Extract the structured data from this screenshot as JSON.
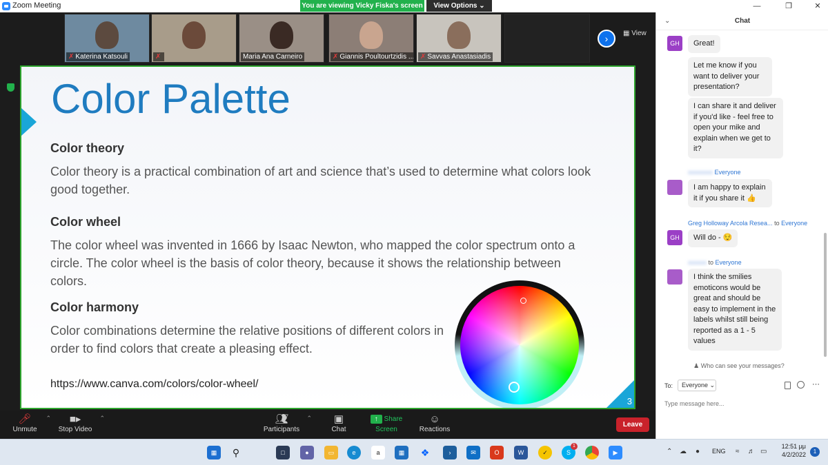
{
  "window": {
    "title": "Zoom Meeting",
    "banner": "You are viewing Vicky Fiska's screen",
    "view_options": "View Options ⌄"
  },
  "colors": {
    "accent": "#0e72ed",
    "share_green": "#22b14c",
    "slide_blue": "#1f7cc0",
    "leave_red": "#c9222b"
  },
  "participants": [
    {
      "name": "Katerina Katsouli",
      "muted": true,
      "bg": "#6e8aa0",
      "person": "#5c4a3f"
    },
    {
      "name": "",
      "muted": true,
      "bg": "#a89c8a",
      "person": "#6b4a3a"
    },
    {
      "name": "Maria Ana Carneiro",
      "muted": false,
      "bg": "#9a8f86",
      "person": "#3a2a24"
    },
    {
      "name": "Giannis Poultourtzidis ...",
      "muted": true,
      "bg": "#8c7e76",
      "person": "#c9a58f"
    },
    {
      "name": "Savvas Anastasiadis",
      "muted": true,
      "bg": "#c8c4bd",
      "person": "#8a6e5c"
    },
    {
      "name": "",
      "muted": false,
      "bg": "#222222",
      "person": "#222222"
    }
  ],
  "view_button": "View",
  "slide": {
    "title": "Color Palette",
    "sections": [
      {
        "heading": "Color theory",
        "body": "Color theory is a practical combination of art and science that’s used to determine what colors look good together."
      },
      {
        "heading": "Color wheel",
        "body": "The color wheel was invented in 1666 by Isaac Newton, who mapped the color spectrum onto a circle. The color wheel is the basis of color theory, because it shows the relationship between colors."
      },
      {
        "heading": "Color harmony",
        "body": "Color combinations determine the relative positions of different colors in order to find colors that create a pleasing effect."
      }
    ],
    "link": "https://www.canva.com/colors/color-wheel/",
    "page_number": "3"
  },
  "toolbar": {
    "unmute": "Unmute",
    "stop_video": "Stop Video",
    "participants": "Participants",
    "participants_count": "27",
    "chat": "Chat",
    "share_screen": "Share Screen",
    "reactions": "Reactions",
    "leave": "Leave"
  },
  "chat": {
    "title": "Chat",
    "messages": [
      {
        "avatar": "GH",
        "text": "Great!"
      },
      {
        "avatar": "",
        "text": "Let me know if you want to deliver your presentation?"
      },
      {
        "avatar": "",
        "text": "I can share it and deliver if you'd like - feel free to open your mike and explain when we get to it?"
      },
      {
        "sender_suffix": "Everyone",
        "avatar": "",
        "text": "I am happy to explain it if you share it 👍"
      },
      {
        "sender": "Greg Holloway Arcola Resea...",
        "sender_to": "to",
        "sender_suffix": "Everyone",
        "avatar": "GH",
        "text": "Will do - 😌"
      },
      {
        "sender_to": "to",
        "sender_suffix": "Everyone",
        "avatar": "",
        "text": "I think the smilies emoticons would be great and should be easy to implement in the labels whilst still being reported as a 1 - 5 values"
      }
    ],
    "who_can_see": "Who can see your messages?",
    "to_label": "To:",
    "to_value": "Everyone",
    "input_placeholder": "Type message here..."
  },
  "taskbar": {
    "icons": [
      "windows-start",
      "search",
      "task-view",
      "teams-chat",
      "file-explorer",
      "edge",
      "amazon",
      "store",
      "dropbox",
      "powershell",
      "mail",
      "office",
      "word",
      "norton",
      "skype",
      "chrome",
      "zoom"
    ],
    "lang": "ENG",
    "time": "12:51 μμ",
    "date": "4/2/2022",
    "notifications": "1",
    "skype_badge": "1"
  }
}
